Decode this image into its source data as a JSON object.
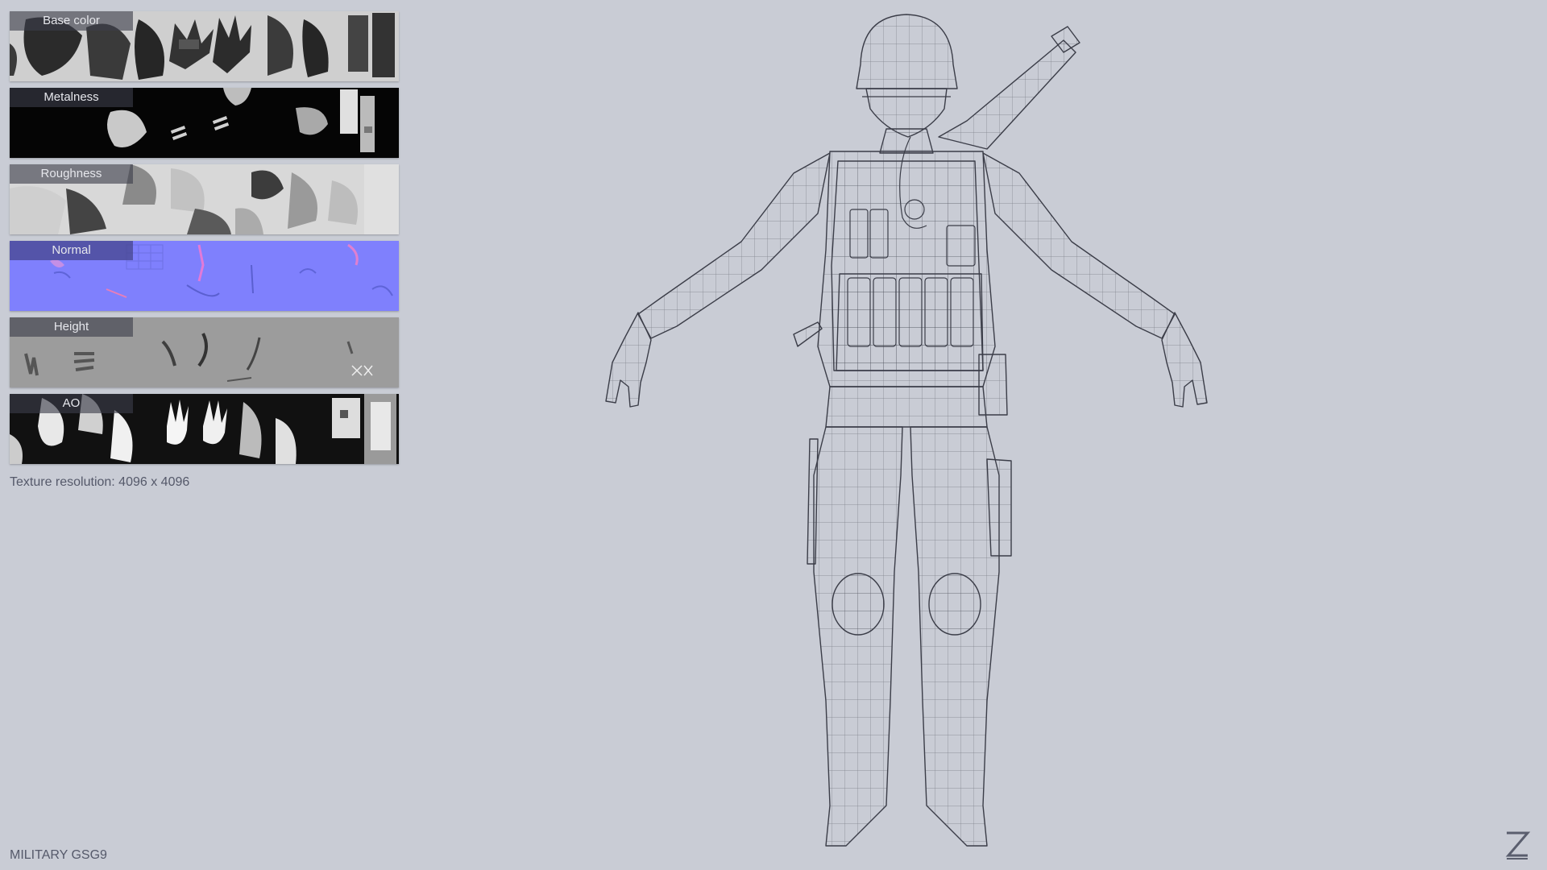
{
  "textures": {
    "base_color": "Base color",
    "metalness": "Metalness",
    "roughness": "Roughness",
    "normal": "Normal",
    "height": "Height",
    "ao": "AO"
  },
  "texture_resolution": "Texture resolution: 4096 x 4096",
  "project_title": "MILITARY GSG9",
  "colors": {
    "background": "#c9ccd5",
    "normal_map": "#7f7fff",
    "wireframe": "#3b3d48"
  },
  "logo_icon": "z-logo-icon"
}
